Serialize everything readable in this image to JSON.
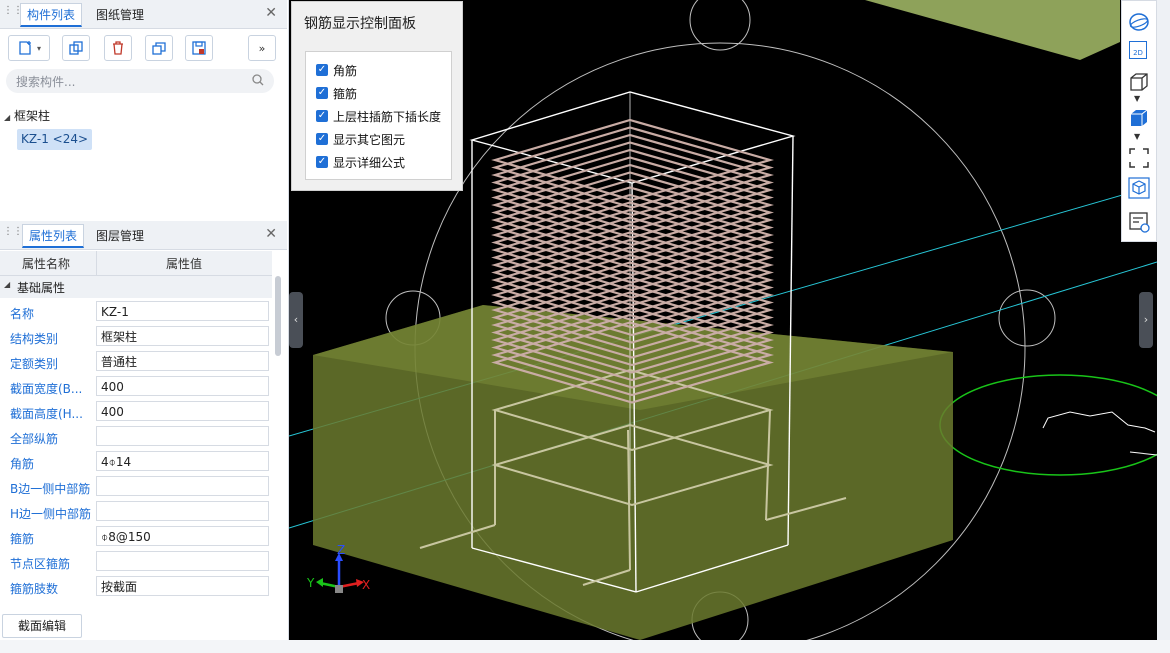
{
  "component_panel": {
    "tabs": [
      "构件列表",
      "图纸管理"
    ],
    "search_placeholder": "搜索构件...",
    "tree_group": "框架柱",
    "tree_item": "KZ-1 <24>"
  },
  "property_panel": {
    "tabs": [
      "属性列表",
      "图层管理"
    ],
    "col_name": "属性名称",
    "col_value": "属性值",
    "section": "基础属性",
    "rows": [
      {
        "name": "名称",
        "value": "KZ-1"
      },
      {
        "name": "结构类别",
        "value": "框架柱"
      },
      {
        "name": "定额类别",
        "value": "普通柱"
      },
      {
        "name": "截面宽度(B...",
        "value": "400"
      },
      {
        "name": "截面高度(H...",
        "value": "400"
      },
      {
        "name": "全部纵筋",
        "value": ""
      },
      {
        "name": "角筋",
        "value": "4⌽14"
      },
      {
        "name": "B边一侧中部筋",
        "value": ""
      },
      {
        "name": "H边一侧中部筋",
        "value": ""
      },
      {
        "name": "箍筋",
        "value": "⌽8@150"
      },
      {
        "name": "节点区箍筋",
        "value": ""
      },
      {
        "name": "箍筋肢数",
        "value": "按截面"
      }
    ],
    "section_edit_button": "截面编辑"
  },
  "rebar_panel": {
    "title": "钢筋显示控制面板",
    "options": [
      {
        "label": "角筋",
        "checked": true
      },
      {
        "label": "箍筋",
        "checked": true
      },
      {
        "label": "上层柱插筋下插长度",
        "checked": true
      },
      {
        "label": "显示其它图元",
        "checked": true
      },
      {
        "label": "显示详细公式",
        "checked": true
      }
    ]
  },
  "axis_labels": {
    "z": "Z",
    "y": "Y",
    "x": "X"
  },
  "right_toolbar": {
    "icons": [
      "orbit-icon",
      "view-2d-icon",
      "view-3d-box-icon",
      "view-3d-solid-icon",
      "fit-view-icon",
      "isometric-icon",
      "properties-view-icon"
    ],
    "view_2d_label": "2D"
  },
  "colors": {
    "accent": "#1f6fd6",
    "concrete": "#6b7a2e",
    "stirrup": "#c6b0a8",
    "frame": "#ffffff",
    "axis_line": "#27c6d6",
    "circle_green": "#19c419"
  }
}
